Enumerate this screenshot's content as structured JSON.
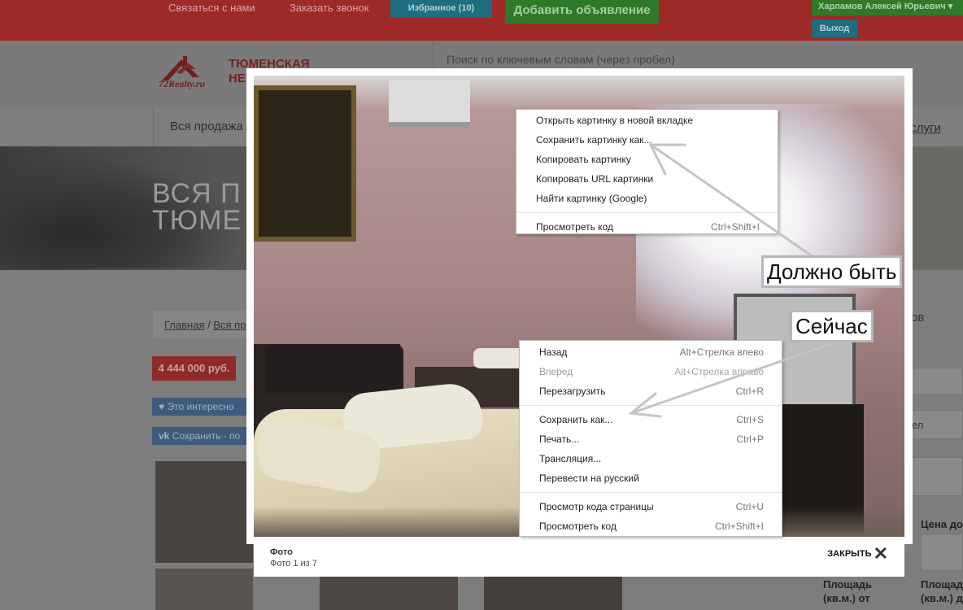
{
  "topbar": {
    "contact": "Связаться с нами",
    "callback": "Заказать звонок",
    "favorites": "Избранное (10)",
    "add_listing": "Добавить объявление",
    "user_name": "Харламов Алексей Юрьевич",
    "logout": "Выход"
  },
  "header": {
    "logo_text": "72Realty.ru",
    "logo_title_1": "ТЮМЕНСКАЯ",
    "logo_title_2": "НЕ",
    "search_placeholder": "Поиск по ключевым словам (через пробел)"
  },
  "nav": {
    "first": "Вся продажа",
    "last": "услуги"
  },
  "banner": {
    "title_1": "ВСЯ П",
    "title_2": "ТЮМЕ"
  },
  "listing": {
    "breadcrumb_home": "Главная",
    "breadcrumb_sep": " / ",
    "breadcrumb_next": "Вся пр",
    "price": "4 444 000 руб.",
    "interest": "Это интересно",
    "vk_save": "Сохранить - по",
    "right_heading": "ов",
    "right_field": "ел",
    "price_from": "Цена до",
    "area_from": "Площадь (кв.м.) от",
    "area_to": "Площадь (кв.м.) д"
  },
  "lightbox": {
    "caption_title": "Фото",
    "caption_count": "Фото 1 из 7",
    "close_label": "ЗАКРЫТЬ"
  },
  "image_menu": {
    "items": [
      {
        "label": "Открыть картинку в новой вкладке",
        "shortcut": ""
      },
      {
        "label": "Сохранить картинку как...",
        "shortcut": ""
      },
      {
        "label": "Копировать картинку",
        "shortcut": ""
      },
      {
        "label": "Копировать URL картинки",
        "shortcut": ""
      },
      {
        "label": "Найти картинку (Google)",
        "shortcut": ""
      },
      {
        "label": "Просмотреть код",
        "shortcut": "Ctrl+Shift+I"
      }
    ]
  },
  "page_menu": {
    "items": [
      {
        "label": "Назад",
        "shortcut": "Alt+Стрелка влево"
      },
      {
        "label": "Вперед",
        "shortcut": "Alt+Стрелка вправо"
      },
      {
        "label": "Перезагрузить",
        "shortcut": "Ctrl+R"
      },
      {
        "label": "Сохранить как...",
        "shortcut": "Ctrl+S"
      },
      {
        "label": "Печать...",
        "shortcut": "Ctrl+P"
      },
      {
        "label": "Трансляция...",
        "shortcut": ""
      },
      {
        "label": "Перевести на русский",
        "shortcut": ""
      },
      {
        "label": "Просмотр кода страницы",
        "shortcut": "Ctrl+U"
      },
      {
        "label": "Просмотреть код",
        "shortcut": "Ctrl+Shift+I"
      }
    ]
  },
  "annotations": {
    "should_be": "Должно быть",
    "now": "Сейчас"
  },
  "colors": {
    "topbar": "#9e2a28",
    "green_button": "#2f7a2a",
    "blue_button": "#1e6e80",
    "price_badge": "#8e2a28",
    "arrow": "#c0c0c0"
  }
}
